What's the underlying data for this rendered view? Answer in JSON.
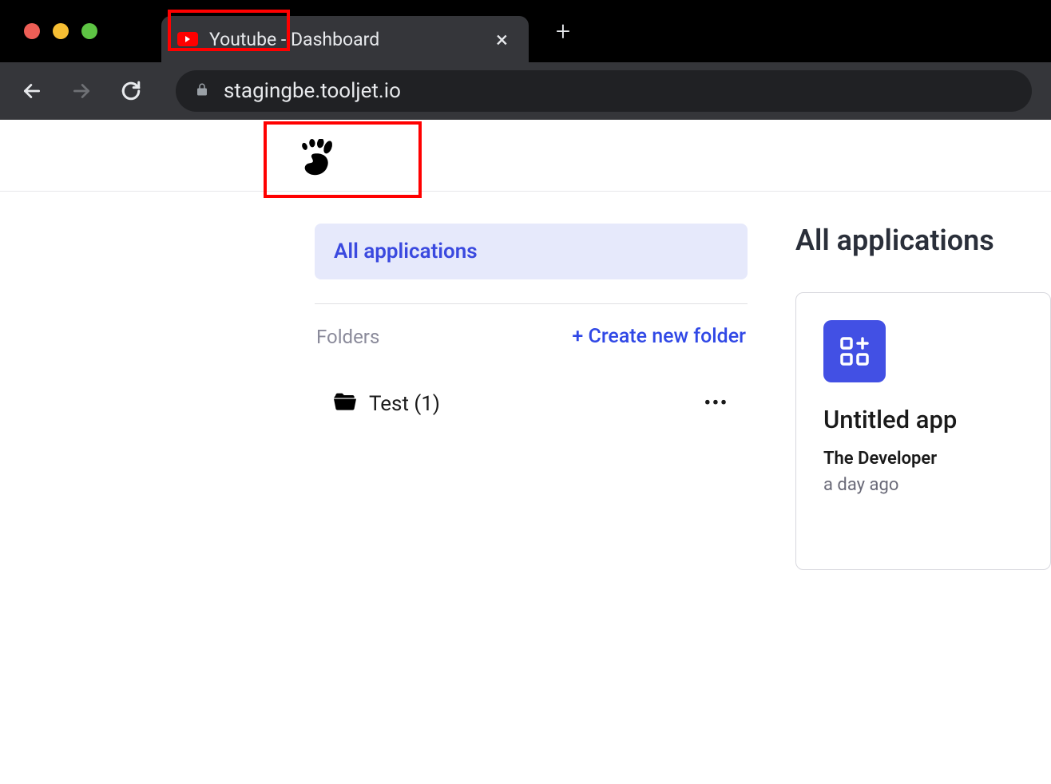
{
  "browser": {
    "tab_title": "Youtube - Dashboard",
    "url": "stagingbe.tooljet.io"
  },
  "sidebar": {
    "all_apps_label": "All applications",
    "folders_label": "Folders",
    "create_folder_label": "+ Create new folder",
    "folders": [
      {
        "name": "Test (1)"
      }
    ]
  },
  "main": {
    "title": "All applications",
    "apps": [
      {
        "title": "Untitled app",
        "author": "The Developer",
        "time": "a day ago"
      }
    ]
  }
}
